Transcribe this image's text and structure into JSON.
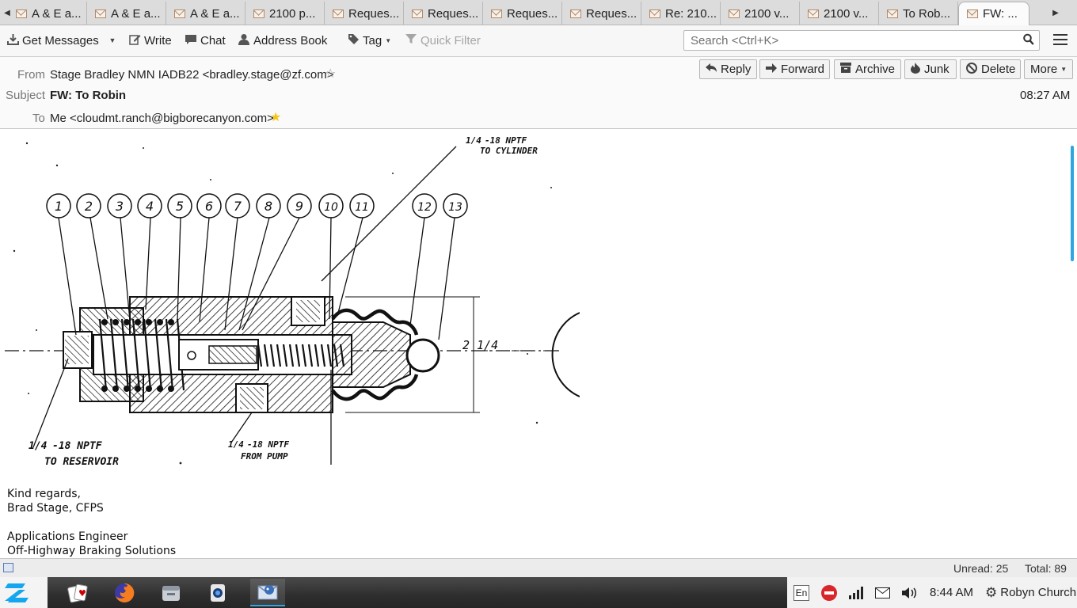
{
  "tabs": {
    "items": [
      {
        "label": "A & E a..."
      },
      {
        "label": "A & E a..."
      },
      {
        "label": "A & E a..."
      },
      {
        "label": "2100 p..."
      },
      {
        "label": "Reques..."
      },
      {
        "label": "Reques..."
      },
      {
        "label": "Reques..."
      },
      {
        "label": "Reques..."
      },
      {
        "label": "Re: 210..."
      },
      {
        "label": "2100 v..."
      },
      {
        "label": "2100 v..."
      },
      {
        "label": "To Rob..."
      }
    ],
    "active": {
      "label": "FW: ..."
    },
    "scroll_left_glyph": "◀",
    "scroll_right_glyph": "▶",
    "close_glyph": "✕"
  },
  "toolbar": {
    "get_messages": "Get Messages",
    "write": "Write",
    "chat": "Chat",
    "address_book": "Address Book",
    "tag": "Tag",
    "quick_filter": "Quick Filter",
    "search_placeholder": "Search <Ctrl+K>"
  },
  "header": {
    "from_label": "From",
    "from_value": "Stage Bradley NMN IADB22 <bradley.stage@zf.com>",
    "subject_label": "Subject",
    "subject_value": "FW: To Robin",
    "to_label": "To",
    "to_value": "Me <cloudmt.ranch@bigborecanyon.com>",
    "time": "08:27 AM",
    "buttons": {
      "reply": "Reply",
      "forward": "Forward",
      "archive": "Archive",
      "junk": "Junk",
      "delete": "Delete",
      "more": "More"
    },
    "star_color": "#f5c518"
  },
  "drawing": {
    "callouts": [
      "1",
      "2",
      "3",
      "4",
      "5",
      "6",
      "7",
      "8",
      "9",
      "10",
      "11",
      "12",
      "13"
    ],
    "note_cylinder_fraction": "1/4",
    "note_cylinder_line1": "-18 NPTF",
    "note_cylinder_line2": "TO CYLINDER",
    "note_reservoir_fraction": "1/4",
    "note_reservoir_line1": "-18 NPTF",
    "note_reservoir_line2": "TO RESERVOIR",
    "note_pump_fraction": "1/4",
    "note_pump_line1": "-18 NPTF",
    "note_pump_line2": "FROM PUMP",
    "dimension": "2 1/4"
  },
  "signature": {
    "lines": [
      "Kind regards,",
      "Brad Stage, CFPS",
      "",
      "Applications Engineer",
      "Off-Highway Braking Solutions"
    ]
  },
  "status": {
    "unread": "Unread: 25",
    "total": "Total: 89"
  },
  "taskbar": {
    "language": "En",
    "clock": "8:44 AM",
    "user": "Robyn Church",
    "apps": [
      {
        "icon": "cards-icon"
      },
      {
        "icon": "firefox-icon"
      },
      {
        "icon": "file-manager-icon"
      },
      {
        "icon": "camera-icon"
      },
      {
        "icon": "thunderbird-icon",
        "active": true
      }
    ]
  }
}
